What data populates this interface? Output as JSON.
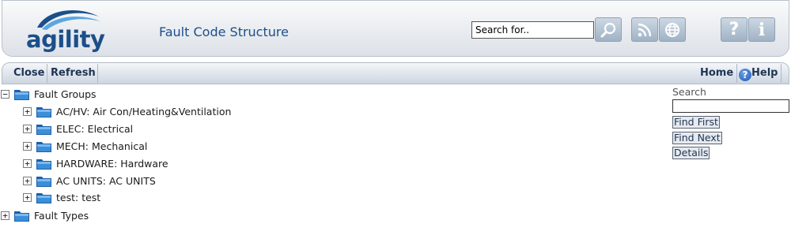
{
  "header": {
    "logo_text": "agility",
    "title": "Fault Code Structure",
    "search": {
      "value": "Search for.."
    },
    "buttons": [
      {
        "icon": "magnifier-icon"
      },
      {
        "icon": "rss-icon"
      },
      {
        "icon": "globe-icon"
      },
      {
        "icon": "help-icon"
      },
      {
        "icon": "info-icon"
      }
    ],
    "help_glyph": "?",
    "info_glyph": "i"
  },
  "toolbar": {
    "close_label": "Close",
    "refresh_label": "Refresh",
    "home_label": "Home",
    "help_label": "Help",
    "help_glyph": "?"
  },
  "tree": {
    "root_groups": {
      "label": "Fault Groups",
      "expanded": true,
      "expander": "−"
    },
    "children": [
      {
        "label": "AC/HV: Air Con/Heating&Ventilation",
        "expander": "+"
      },
      {
        "label": "ELEC: Electrical",
        "expander": "+"
      },
      {
        "label": "MECH: Mechanical",
        "expander": "+"
      },
      {
        "label": "HARDWARE: Hardware",
        "expander": "+"
      },
      {
        "label": "AC UNITS: AC UNITS",
        "expander": "+"
      },
      {
        "label": "test: test",
        "expander": "+"
      }
    ],
    "root_types": {
      "label": "Fault Types",
      "expanded": false,
      "expander": "+"
    }
  },
  "side_panel": {
    "title": "Search",
    "input_value": "",
    "find_first": "Find First",
    "find_next": "Find Next",
    "details": "Details"
  },
  "colors": {
    "brand": "#1c4f8a",
    "button_blue": "#9fb2c5",
    "folder_blue": "#2f7fc6"
  }
}
